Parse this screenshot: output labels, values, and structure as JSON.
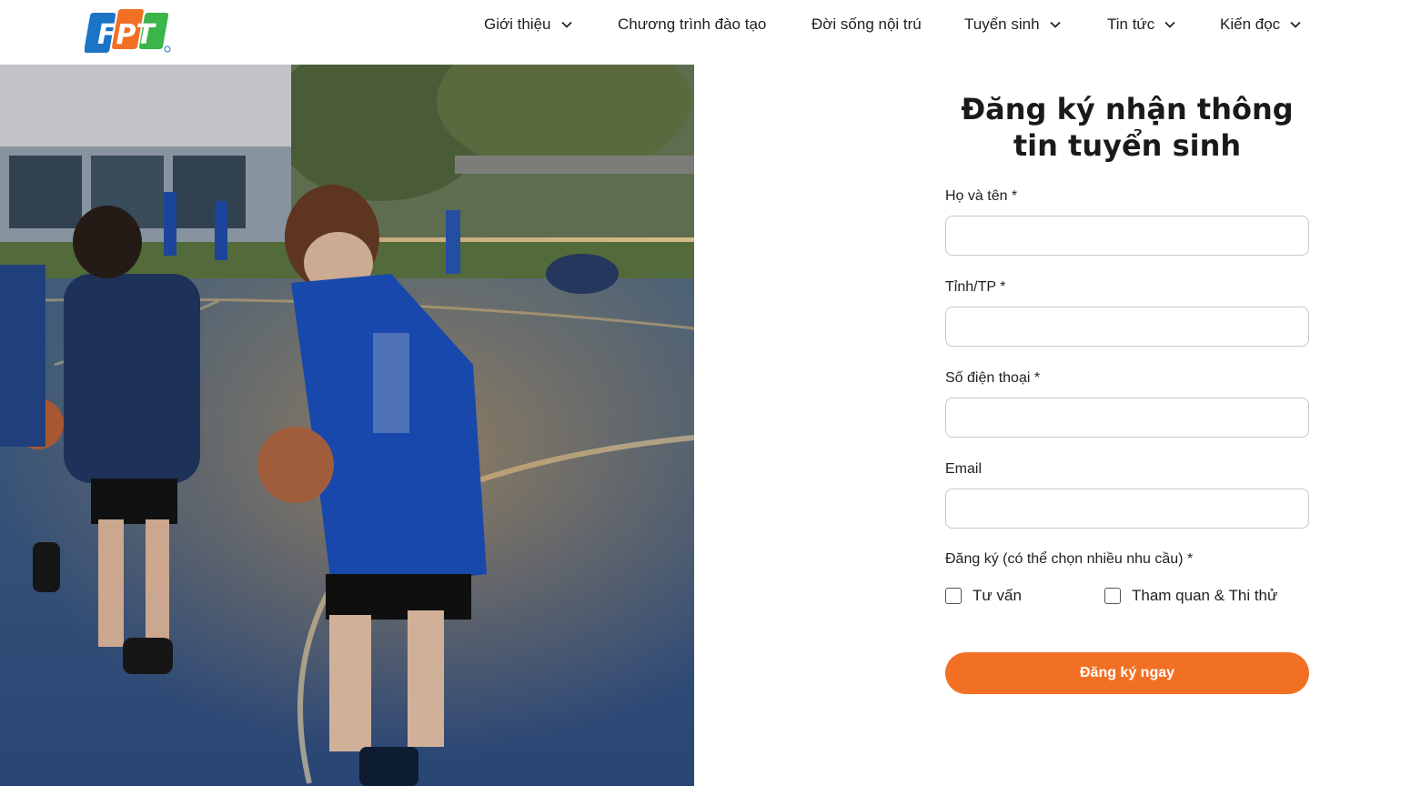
{
  "brand": {
    "logo_text": "FPT",
    "colors": {
      "blue": "#1b74c5",
      "orange": "#f27024",
      "green": "#3bb44a"
    }
  },
  "nav": {
    "items": [
      {
        "label": "Giới thiệu",
        "has_dropdown": true
      },
      {
        "label": "Chương trình đào tạo",
        "has_dropdown": false
      },
      {
        "label": "Đời sống nội trú",
        "has_dropdown": false
      },
      {
        "label": "Tuyển sinh",
        "has_dropdown": true
      },
      {
        "label": "Tin tức",
        "has_dropdown": true
      },
      {
        "label": "Kiến đọc",
        "has_dropdown": true
      }
    ]
  },
  "form": {
    "title_line1": "Đăng ký nhận thông",
    "title_line2": "tin tuyển sinh",
    "fields": [
      {
        "label": "Họ và tên *",
        "value": "",
        "placeholder": ""
      },
      {
        "label": "Tỉnh/TP *",
        "value": "",
        "placeholder": ""
      },
      {
        "label": "Số điện thoại *",
        "value": "",
        "placeholder": ""
      },
      {
        "label": "Email",
        "value": "",
        "placeholder": ""
      }
    ],
    "interest_label": "Đăng ký (có thể chọn nhiều nhu cầu) *",
    "options": [
      {
        "label": "Tư vấn",
        "checked": false
      },
      {
        "label": "Tham quan & Thi thử",
        "checked": false
      }
    ],
    "submit_label": "Đăng ký ngay"
  }
}
